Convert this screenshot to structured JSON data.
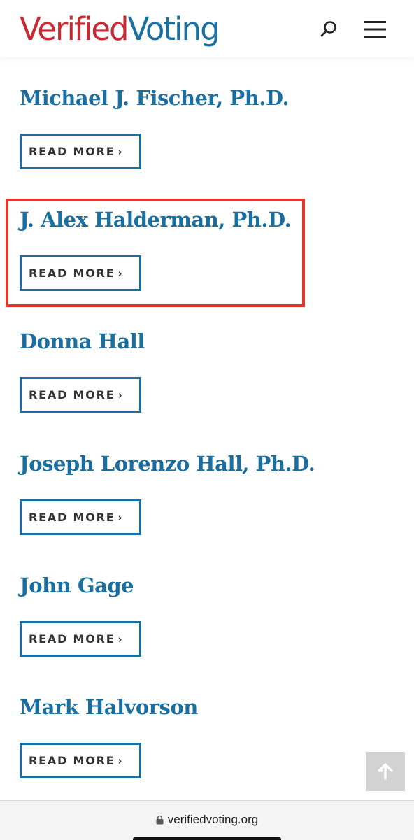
{
  "header": {
    "logo_part1": "Verified",
    "logo_part2": "Voting",
    "search_icon": "search-icon",
    "menu_icon": "hamburger-menu-icon"
  },
  "entries": [
    {
      "name": "Michael J. Fischer, Ph.D.",
      "button_label": "READ MORE"
    },
    {
      "name": "J. Alex Halderman, Ph.D.",
      "button_label": "READ MORE"
    },
    {
      "name": "Donna Hall",
      "button_label": "READ MORE"
    },
    {
      "name": "Joseph Lorenzo Hall, Ph.D.",
      "button_label": "READ MORE"
    },
    {
      "name": "John Gage",
      "button_label": "READ MORE"
    },
    {
      "name": "Mark Halvorson",
      "button_label": "READ MORE"
    }
  ],
  "chevron_glyph": "›",
  "scroll_top_icon": "arrow-up-icon",
  "browser": {
    "url": "verifiedvoting.org",
    "lock_icon": "lock-icon"
  },
  "colors": {
    "brand_red": "#c62a32",
    "brand_blue": "#1a6fa0",
    "highlight_red": "#e5342e",
    "button_text": "#333333",
    "scroll_top_bg": "#d2d2d2"
  }
}
